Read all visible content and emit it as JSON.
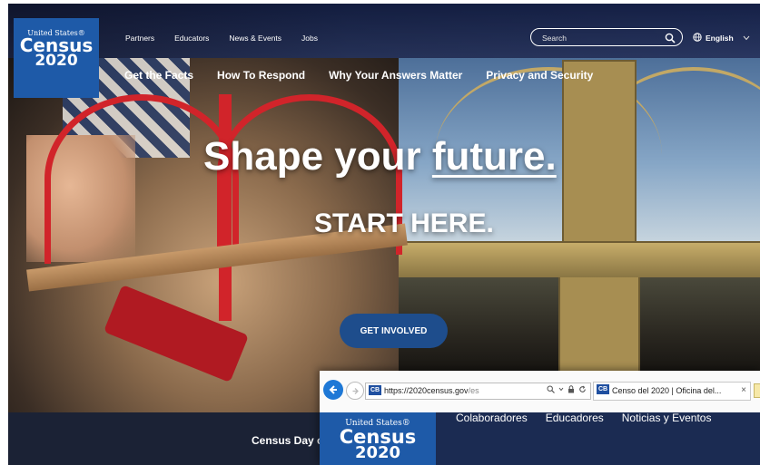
{
  "logo": {
    "line1": "United States®",
    "line2": "Census",
    "line3": "2020"
  },
  "utility_nav": [
    "Partners",
    "Educators",
    "News & Events",
    "Jobs"
  ],
  "main_nav": [
    "Get the Facts",
    "How To Respond",
    "Why Your Answers Matter",
    "Privacy and Security"
  ],
  "search": {
    "placeholder": "Search"
  },
  "language": {
    "label": "English"
  },
  "hero": {
    "headline_prefix": "Shape your",
    "headline_emphasis": "future.",
    "subheadline": "START HERE.",
    "cta": "GET INVOLVED"
  },
  "band": {
    "text": "Census Day co"
  },
  "browser": {
    "address": {
      "host": "https://2020census.gov",
      "path": "/es"
    },
    "favicon_text": "CB",
    "tab_title": "Censo del 2020 | Oficina del...",
    "tab_close": "×",
    "logo": {
      "line1": "United States®",
      "line2": "Census",
      "line3": "2020"
    },
    "nav": [
      "Colaboradores",
      "Educadores",
      "Noticias y Eventos"
    ]
  },
  "colors": {
    "brand_blue": "#1e5aa8",
    "cta_blue": "#1e4d8c",
    "band": "#1b2235"
  },
  "icons": [
    "search-icon",
    "globe-icon",
    "chevron-down-icon",
    "back-arrow-icon",
    "forward-arrow-icon",
    "lock-icon",
    "refresh-icon"
  ]
}
